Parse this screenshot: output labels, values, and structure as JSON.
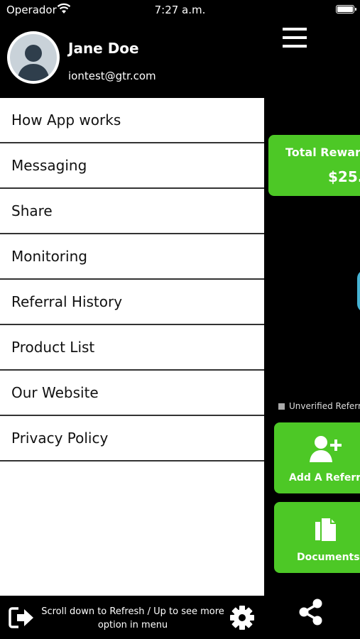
{
  "status_bar": {
    "carrier": "Operador",
    "time": "7:27 a.m."
  },
  "drawer": {
    "user": {
      "name": "Jane Doe",
      "email": "iontest@gtr.com"
    },
    "menu_items": [
      {
        "label": "How App works"
      },
      {
        "label": "Messaging"
      },
      {
        "label": "Share"
      },
      {
        "label": "Monitoring"
      },
      {
        "label": "Referral History"
      },
      {
        "label": "Product List"
      },
      {
        "label": "Our Website"
      },
      {
        "label": "Privacy Policy"
      }
    ],
    "footer": {
      "hint": "Scroll down to Refresh / Up to see more option in menu"
    }
  },
  "background_screen": {
    "reward_card": {
      "title": "Total Rewar",
      "amount": "$25."
    },
    "legend": {
      "label": "Unverified Referr"
    },
    "actions": [
      {
        "label": "Add A Referra"
      },
      {
        "label": "Documents"
      }
    ]
  },
  "colors": {
    "accent_green": "#4dc826",
    "menu_bg": "#ffffff",
    "background": "#000000",
    "chart_arc": "#46b3d4"
  }
}
